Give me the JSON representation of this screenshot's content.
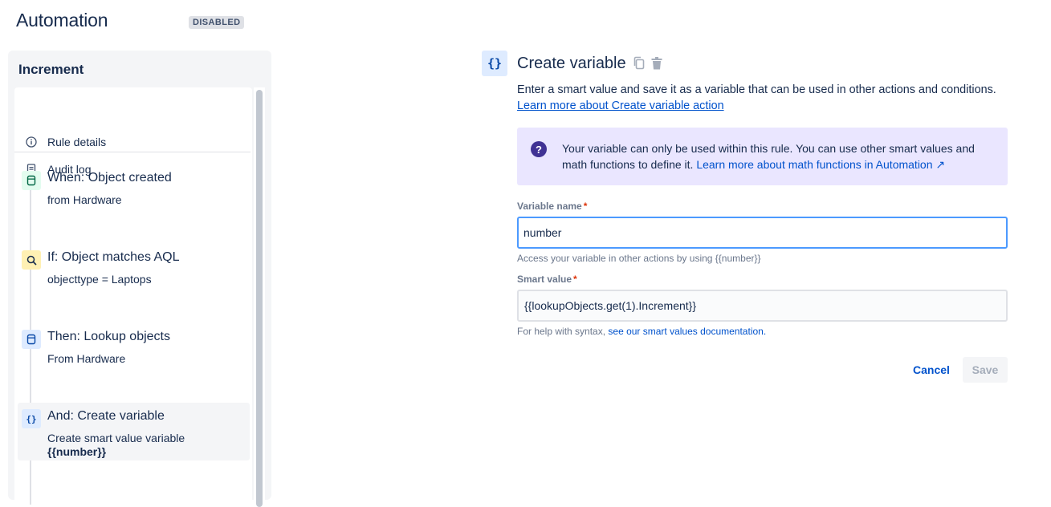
{
  "header": {
    "title": "Automation",
    "status": "DISABLED"
  },
  "rule": {
    "name": "Increment",
    "menu": [
      {
        "label": "Rule details",
        "icon": "info-icon"
      },
      {
        "label": "Audit log",
        "icon": "document-icon"
      }
    ],
    "components": [
      {
        "title": "When: Object created",
        "subtitle": "from Hardware",
        "icon": "object-trigger-icon",
        "color": "#e3fcef"
      },
      {
        "title": "If: Object matches AQL",
        "subtitle": "objecttype = Laptops",
        "icon": "search-icon",
        "color": "#fff0b3"
      },
      {
        "title": "Then: Lookup objects",
        "subtitle": "From Hardware",
        "icon": "object-action-icon",
        "color": "#deebff"
      },
      {
        "title": "And: Create variable",
        "subtitle": "Create smart value variable",
        "subtitle2": "{{number}}",
        "icon": "braces-icon",
        "icon_glyph": "{}",
        "color": "#deebff"
      }
    ]
  },
  "editor": {
    "icon_glyph": "{}",
    "title": "Create variable",
    "description": "Enter a smart value and save it as a variable that can be used in other actions and conditions.",
    "learn_link": "Learn more about Create variable action",
    "info": {
      "text": "Your variable can only be used within this rule. You can use other smart values and math functions to define it.",
      "link": "Learn more about math functions in Automation ↗"
    },
    "variable_name": {
      "label": "Variable name",
      "required_mark": "*",
      "value": "number",
      "helper": "Access your variable in other actions by using {{number}}"
    },
    "smart_value": {
      "label": "Smart value",
      "required_mark": "*",
      "value": "{{lookupObjects.get(1).Increment}}",
      "helper_prefix": "For help with syntax, ",
      "helper_link": "see our smart values documentation."
    },
    "buttons": {
      "cancel": "Cancel",
      "save": "Save"
    }
  },
  "colors": {
    "link": "#0052cc",
    "info_bg": "#eae6ff",
    "info_icon": "#403294",
    "focus_border": "#4c9aff",
    "required": "#de350b"
  }
}
